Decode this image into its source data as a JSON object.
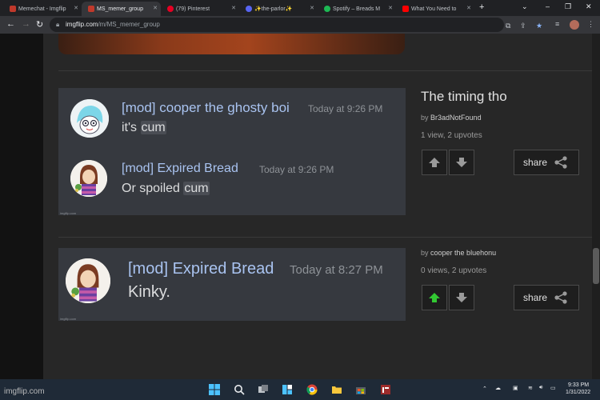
{
  "browser": {
    "tabs": [
      {
        "label": "Memechat - Imgflip",
        "favicon_color": "#c0392b",
        "active": false
      },
      {
        "label": "MS_memer_group",
        "favicon_color": "#c0392b",
        "active": true
      },
      {
        "label": "(79) Pinterest",
        "favicon_color": "#e60023",
        "active": false
      },
      {
        "label": "✨the-parlor✨",
        "favicon_color": "#5865f2",
        "active": false
      },
      {
        "label": "Spotify – Breads M",
        "favicon_color": "#1db954",
        "active": false
      },
      {
        "label": "What You Need to",
        "favicon_color": "#ff0000",
        "active": false
      }
    ],
    "new_tab_glyph": "+",
    "url_host": "imgflip.com",
    "url_path": "/m/MS_memer_group"
  },
  "posts": [
    {
      "messages": [
        {
          "name": "[mod] cooper the ghosty boi",
          "name_color": "#e6d36e",
          "time": "Today at 9:26 PM",
          "text_before": "it's ",
          "highlight": "cum",
          "avatar": "ghost-avatar"
        },
        {
          "name": "[mod] Expired Bread",
          "name_color": "#a9c3f0",
          "time": "Today at 9:26 PM",
          "text_before": "Or spoiled ",
          "highlight": "cum",
          "avatar": "bread-avatar"
        }
      ],
      "watermark": "imgflip.com",
      "title": "The timing tho",
      "by_prefix": "by",
      "author": "Br3adNotFound",
      "stats": "1 view, 2 upvotes",
      "upvoted": false,
      "share_label": "share"
    },
    {
      "messages": [
        {
          "name": "[mod] Expired Bread",
          "name_color": "#a9c3f0",
          "time": "Today at 8:27 PM",
          "text_before": "Kinky.",
          "highlight": "",
          "avatar": "bread-avatar"
        }
      ],
      "watermark": "imgflip.com",
      "title": "",
      "by_prefix": "by",
      "author": "cooper  the  bluehonu",
      "stats": "0 views, 2 upvotes",
      "upvoted": true,
      "share_label": "share"
    }
  ],
  "watermark": "imgflip.com",
  "taskbar": {
    "time": "9:33 PM",
    "date": "1/31/2022"
  },
  "colors": {
    "upvote_active": "#32c832",
    "vote_inactive": "#9a9a9a"
  }
}
